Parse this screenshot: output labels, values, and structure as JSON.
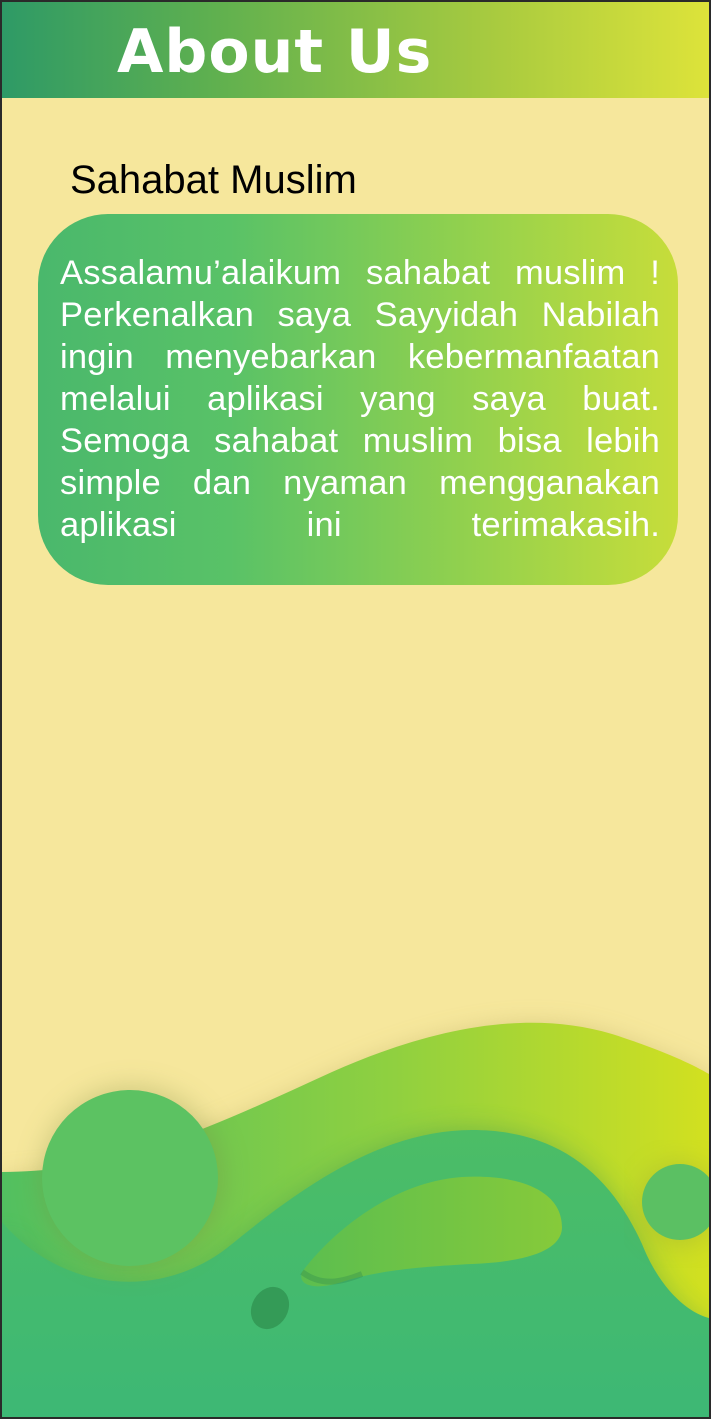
{
  "header": {
    "title": "About Us"
  },
  "section": {
    "title": "Sahabat Muslim"
  },
  "card": {
    "text": "Assalamu’alaikum sahabat muslim ! Perkenalkan saya Sayyidah Nabilah ingin menyebarkan kebermanfaatan melalui aplikasi yang saya buat. Semoga sahabat muslim bisa lebih simple dan nyaman mengganakan aplikasi ini terimakasih."
  },
  "colors": {
    "background": "#f6e79c",
    "header_start": "#2e9a66",
    "header_end": "#dde33a",
    "card_start": "#4ab86c",
    "card_end": "#c7dd3a",
    "wave_green": "#42ba70",
    "wave_lime": "#c8de24"
  }
}
